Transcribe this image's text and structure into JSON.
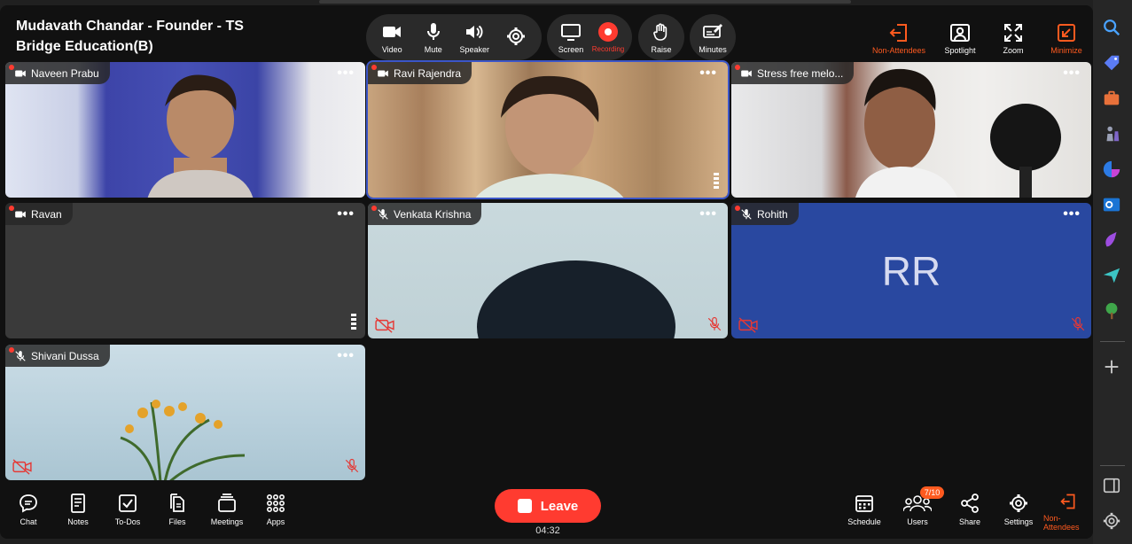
{
  "meeting": {
    "title": "Mudavath Chandar - Founder - TS Bridge Education(B)",
    "timer": "04:32",
    "users_badge": "7/10"
  },
  "toolbar": {
    "video": "Video",
    "mute": "Mute",
    "speaker": "Speaker",
    "screen": "Screen",
    "recording": "Recording",
    "raise": "Raise",
    "minutes": "Minutes",
    "non_attendees": "Non-Attendees",
    "spotlight": "Spotlight",
    "zoom": "Zoom",
    "minimize": "Minimize"
  },
  "participants": [
    {
      "name": "Naveen Prabu",
      "initials": ""
    },
    {
      "name": "Ravi Rajendra",
      "initials": ""
    },
    {
      "name": "Stress free melo...",
      "initials": ""
    },
    {
      "name": "Ravan",
      "initials": ""
    },
    {
      "name": "Venkata Krishna",
      "initials": ""
    },
    {
      "name": "Rohith",
      "initials": "RR"
    },
    {
      "name": "Shivani Dussa",
      "initials": ""
    }
  ],
  "bottombar": {
    "chat": "Chat",
    "notes": "Notes",
    "todos": "To-Dos",
    "files": "Files",
    "meetings": "Meetings",
    "apps": "Apps",
    "leave": "Leave",
    "schedule": "Schedule",
    "users": "Users",
    "share": "Share",
    "settings": "Settings",
    "non_attendees": "Non-Attendees"
  },
  "colors": {
    "accent_orange": "#ff5a1f",
    "leave_red": "#ff3b30",
    "active_outline": "#3b55c8",
    "rohith_tile": "#2948a0"
  }
}
